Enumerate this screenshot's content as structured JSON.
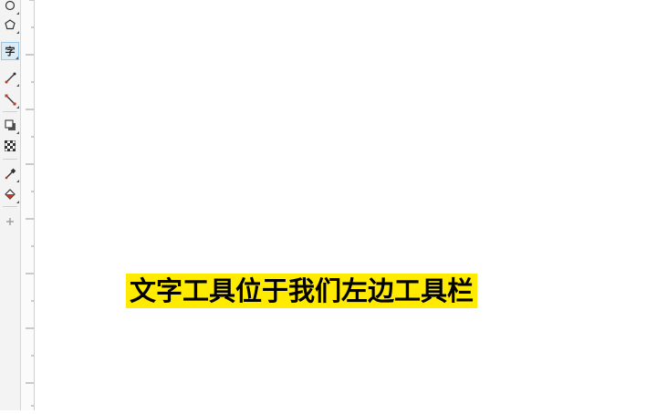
{
  "toolbar": {
    "tools": [
      {
        "icon": "ellipse-icon"
      },
      {
        "icon": "polygon-icon"
      },
      {
        "icon": "text-tool-icon",
        "label": "字",
        "active": true
      },
      {
        "icon": "line-tool-icon"
      },
      {
        "icon": "connector-tool-icon"
      },
      {
        "icon": "drop-shadow-icon"
      },
      {
        "icon": "transparency-icon"
      },
      {
        "icon": "eyedropper-icon"
      },
      {
        "icon": "fill-tool-icon"
      },
      {
        "icon": "add-tool-icon"
      }
    ]
  },
  "caption": {
    "text": "文字工具位于我们左边工具栏"
  },
  "colors": {
    "caption_background": "#ffeb00",
    "caption_text": "#000000",
    "toolbar_background": "#f3f3f3",
    "active_tool_highlight": "#dcecf7"
  }
}
